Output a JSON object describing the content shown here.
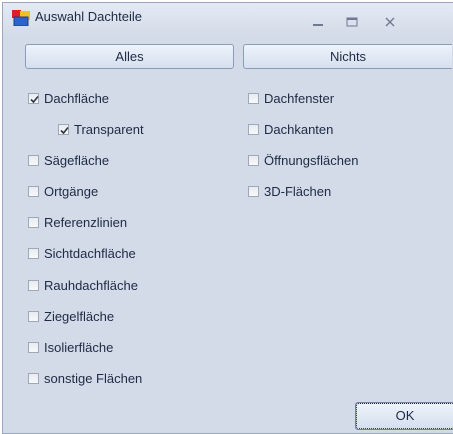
{
  "window": {
    "title": "Auswahl Dachteile"
  },
  "buttons": {
    "all_label": "Alles",
    "none_label": "Nichts",
    "ok_label": "OK"
  },
  "left_column": [
    {
      "label": "Dachfläche",
      "checked": true
    },
    {
      "label": "Transparent",
      "checked": true
    },
    {
      "label": "Sägefläche",
      "checked": false
    },
    {
      "label": "Ortgänge",
      "checked": false
    },
    {
      "label": "Referenzlinien",
      "checked": false
    },
    {
      "label": "Sichtdachfläche",
      "checked": false
    },
    {
      "label": "Rauhdachfläche",
      "checked": false
    },
    {
      "label": "Ziegelfläche",
      "checked": false
    },
    {
      "label": "Isolierfläche",
      "checked": false
    },
    {
      "label": "sonstige Flächen",
      "checked": false
    }
  ],
  "right_column": [
    {
      "label": "Dachfenster",
      "checked": false
    },
    {
      "label": "Dachkanten",
      "checked": false
    },
    {
      "label": "Öffnungsflächen",
      "checked": false
    },
    {
      "label": "3D-Flächen",
      "checked": false
    }
  ],
  "colors": {
    "window_bg": "#d4dbe8",
    "text": "#1c2a44",
    "checkbox_border": "#9ea8b8"
  },
  "icons": {
    "app": "app-icon",
    "minimize": "minimize-icon",
    "maximize": "maximize-icon",
    "close": "close-icon",
    "check": "checkmark-icon"
  }
}
